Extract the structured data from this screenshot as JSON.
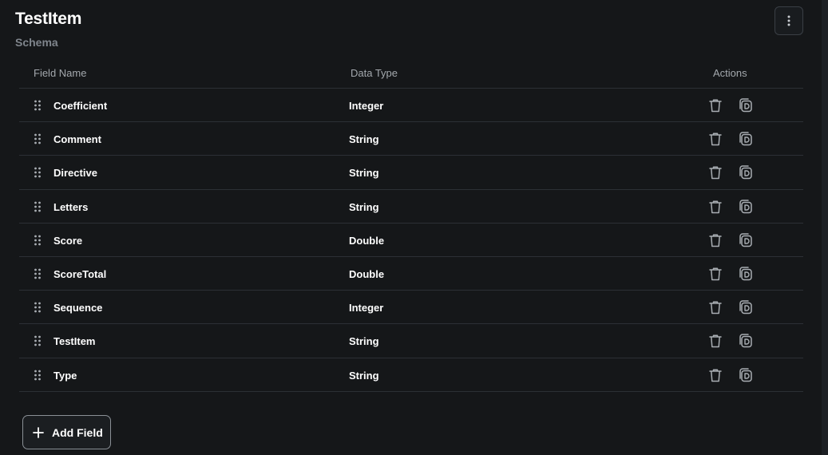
{
  "header": {
    "title": "TestItem",
    "subtitle": "Schema",
    "more_icon": "more-vertical-icon"
  },
  "table": {
    "columns": {
      "name": "Field Name",
      "type": "Data Type",
      "actions": "Actions"
    },
    "rows": [
      {
        "name": "Coefficient",
        "type": "Integer"
      },
      {
        "name": "Comment",
        "type": "String"
      },
      {
        "name": "Directive",
        "type": "String"
      },
      {
        "name": "Letters",
        "type": "String"
      },
      {
        "name": "Score",
        "type": "Double"
      },
      {
        "name": "ScoreTotal",
        "type": "Double"
      },
      {
        "name": "Sequence",
        "type": "Integer"
      },
      {
        "name": "TestItem",
        "type": "String"
      },
      {
        "name": "Type",
        "type": "String"
      }
    ],
    "row_icons": {
      "drag": "drag-handle-icon",
      "delete": "trash-icon",
      "duplicate": "duplicate-icon"
    }
  },
  "add_field": {
    "label": "Add Field",
    "icon": "plus-icon"
  },
  "colors": {
    "background": "#151719",
    "divider": "#2c3035",
    "muted_text": "#7f858c",
    "icon": "#a9aeb3"
  }
}
